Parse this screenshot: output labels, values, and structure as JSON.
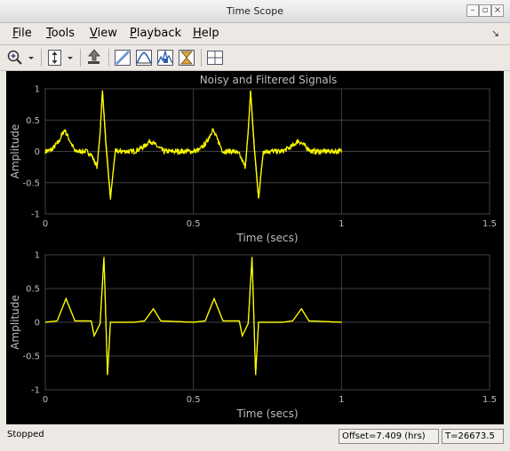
{
  "window": {
    "title": "Time Scope"
  },
  "menu": [
    {
      "label": "File",
      "key": "F",
      "rest": "ile"
    },
    {
      "label": "Tools",
      "key": "T",
      "rest": "ools"
    },
    {
      "label": "View",
      "key": "V",
      "rest": "iew"
    },
    {
      "label": "Playback",
      "key": "P",
      "rest": "layback"
    },
    {
      "label": "Help",
      "key": "H",
      "rest": "elp"
    }
  ],
  "toolbar": [
    "zoom-in-icon",
    "zoom-dropdown-icon",
    "scale-axes-icon",
    "restore-view-icon",
    "triggers-icon",
    "signal-statistics-icon",
    "peak-finder-icon",
    "bilevel-measurements-icon",
    "cursor-measurements-icon",
    "layout-icon"
  ],
  "plot_title": "Noisy and Filtered Signals",
  "status": {
    "state": "Stopped",
    "offset": "Offset=7.409 (hrs)",
    "time": "T=26673.5"
  },
  "colors": {
    "background": "#000000",
    "trace": "#ffff00",
    "grid": "#404040",
    "axis_text": "#bdbdbd"
  },
  "chart_data": [
    {
      "type": "line",
      "title": "Noisy and Filtered Signals",
      "xlabel": "Time (secs)",
      "ylabel": "Amplitude",
      "xlim": [
        0,
        1.5
      ],
      "ylim": [
        -1,
        1
      ],
      "xticks": [
        "0",
        "0.5",
        "1",
        "1.5"
      ],
      "yticks": [
        "1",
        "0.5",
        "0",
        "-0.5",
        "-1"
      ],
      "grid": true,
      "series": [
        {
          "x": [
            0,
            0.02,
            0.045,
            0.065,
            0.085,
            0.1,
            0.14,
            0.155,
            0.175,
            0.185,
            0.193,
            0.205,
            0.22,
            0.236,
            0.26,
            0.3,
            0.33,
            0.355,
            0.38,
            0.4,
            0.45,
            0.5,
            0.52,
            0.545,
            0.565,
            0.585,
            0.6,
            0.64,
            0.655,
            0.675,
            0.685,
            0.693,
            0.705,
            0.72,
            0.736,
            0.76,
            0.8,
            0.83,
            0.855,
            0.88,
            0.9,
            0.95,
            1.0
          ],
          "y": [
            0,
            0.02,
            0.15,
            0.35,
            0.15,
            0,
            0,
            -0.05,
            -0.25,
            0.3,
            0.97,
            0.1,
            -0.75,
            0,
            0,
            0,
            0.07,
            0.17,
            0.07,
            0,
            0,
            0,
            0.02,
            0.15,
            0.35,
            0.15,
            0,
            0,
            -0.05,
            -0.25,
            0.3,
            0.97,
            0.1,
            -0.75,
            0,
            0,
            0,
            0.07,
            0.17,
            0.07,
            0,
            0,
            0
          ],
          "noise_amplitude": 0.04
        }
      ]
    },
    {
      "type": "line",
      "xlabel": "Time (secs)",
      "ylabel": "Amplitude",
      "xlim": [
        0,
        1.5
      ],
      "ylim": [
        -1,
        1
      ],
      "xticks": [
        "0",
        "0.5",
        "1",
        "1.5"
      ],
      "yticks": [
        "1",
        "0.5",
        "0",
        "-0.5",
        "-1"
      ],
      "grid": true,
      "series": [
        {
          "x": [
            0,
            0.04,
            0.07,
            0.1,
            0.155,
            0.165,
            0.185,
            0.198,
            0.21,
            0.22,
            0.23,
            0.3,
            0.335,
            0.365,
            0.39,
            0.5,
            0.54,
            0.57,
            0.6,
            0.655,
            0.665,
            0.685,
            0.698,
            0.71,
            0.72,
            0.73,
            0.8,
            0.835,
            0.865,
            0.89,
            1.0
          ],
          "y": [
            0,
            0.02,
            0.35,
            0.02,
            0.02,
            -0.2,
            -0.02,
            0.97,
            -0.78,
            0,
            0,
            0,
            0.02,
            0.2,
            0.02,
            0,
            0.02,
            0.35,
            0.02,
            0.02,
            -0.2,
            -0.02,
            0.97,
            -0.78,
            0,
            0,
            0,
            0.02,
            0.2,
            0.02,
            0
          ]
        }
      ]
    }
  ]
}
